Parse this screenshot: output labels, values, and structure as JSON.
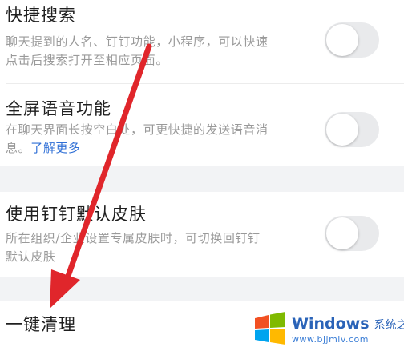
{
  "settings": {
    "quick_search": {
      "title": "快捷搜索",
      "desc_line1": "聊天提到的人名、钉钉功能，小程序，可以快速",
      "desc_line2": "点击后搜索打开至相应页面。",
      "enabled": false
    },
    "fullscreen_voice": {
      "title": "全屏语音功能",
      "desc_line1": "在聊天界面长按空白处，可更快捷的发送语音消",
      "desc_line2_prefix": "息。",
      "desc_link": "了解更多",
      "enabled": false
    },
    "default_skin": {
      "title": "使用钉钉默认皮肤",
      "desc_line1": "所在组织/企业设置专属皮肤时，可切换回钉钉",
      "desc_line2": "默认皮肤",
      "enabled": false
    },
    "one_click_clean": {
      "title": "一键清理"
    }
  },
  "watermark": {
    "brand": "Windows",
    "brand_cn": "系统之家",
    "url": "www.bjjmlv.com"
  },
  "colors": {
    "background": "#f2f3f5",
    "card": "#ffffff",
    "toggle_off": "#e9eaec",
    "link": "#2f6fd6",
    "annotation_arrow": "#e0262b"
  },
  "icons": {
    "annotation": "red-arrow-icon",
    "watermark_logo": "windows-logo-icon"
  }
}
